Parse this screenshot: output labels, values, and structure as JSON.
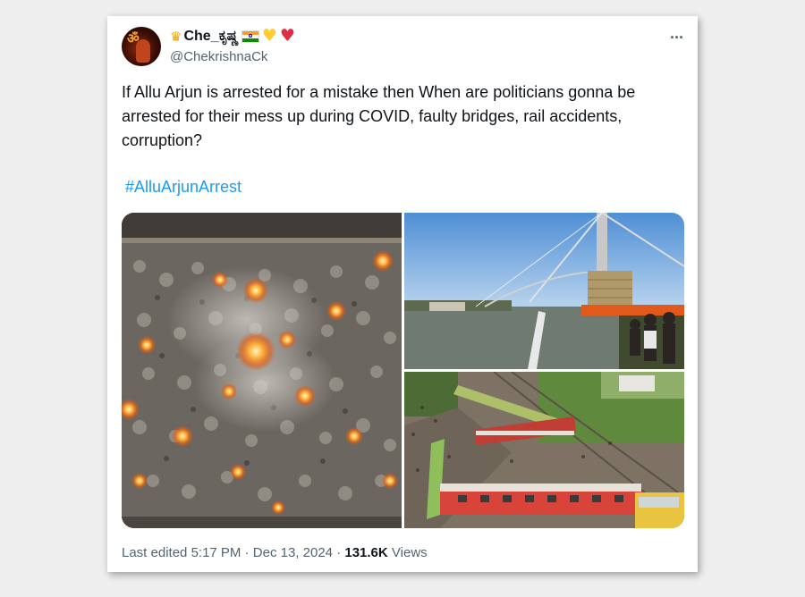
{
  "author": {
    "display_name": "Che_ಕೃಷ್ಣ",
    "handle": "@ChekrishnaCk",
    "avatar_glyph": "ॐ",
    "badges": [
      "crown-icon",
      "indian-flag-icon",
      "yellow-heart-icon",
      "red-heart-icon"
    ]
  },
  "tweet": {
    "text": "If Allu Arjun is arrested for a mistake then When are politicians gonna be arrested for their mess up during COVID, faulty bridges, rail accidents, corruption?",
    "hashtag": "#AlluArjunArrest"
  },
  "media": [
    {
      "name": "cremation-ground-aerial-photo"
    },
    {
      "name": "collapsed-bridge-photo"
    },
    {
      "name": "train-accident-photo"
    }
  ],
  "footer": {
    "edited_label": "Last edited",
    "time": "5:17 PM",
    "date": "Dec 13, 2024",
    "separator": "·",
    "views_count": "131.6K",
    "views_label": "Views"
  },
  "colors": {
    "link": "#1d9bf0",
    "text": "#0f1419",
    "secondary": "#536471"
  }
}
